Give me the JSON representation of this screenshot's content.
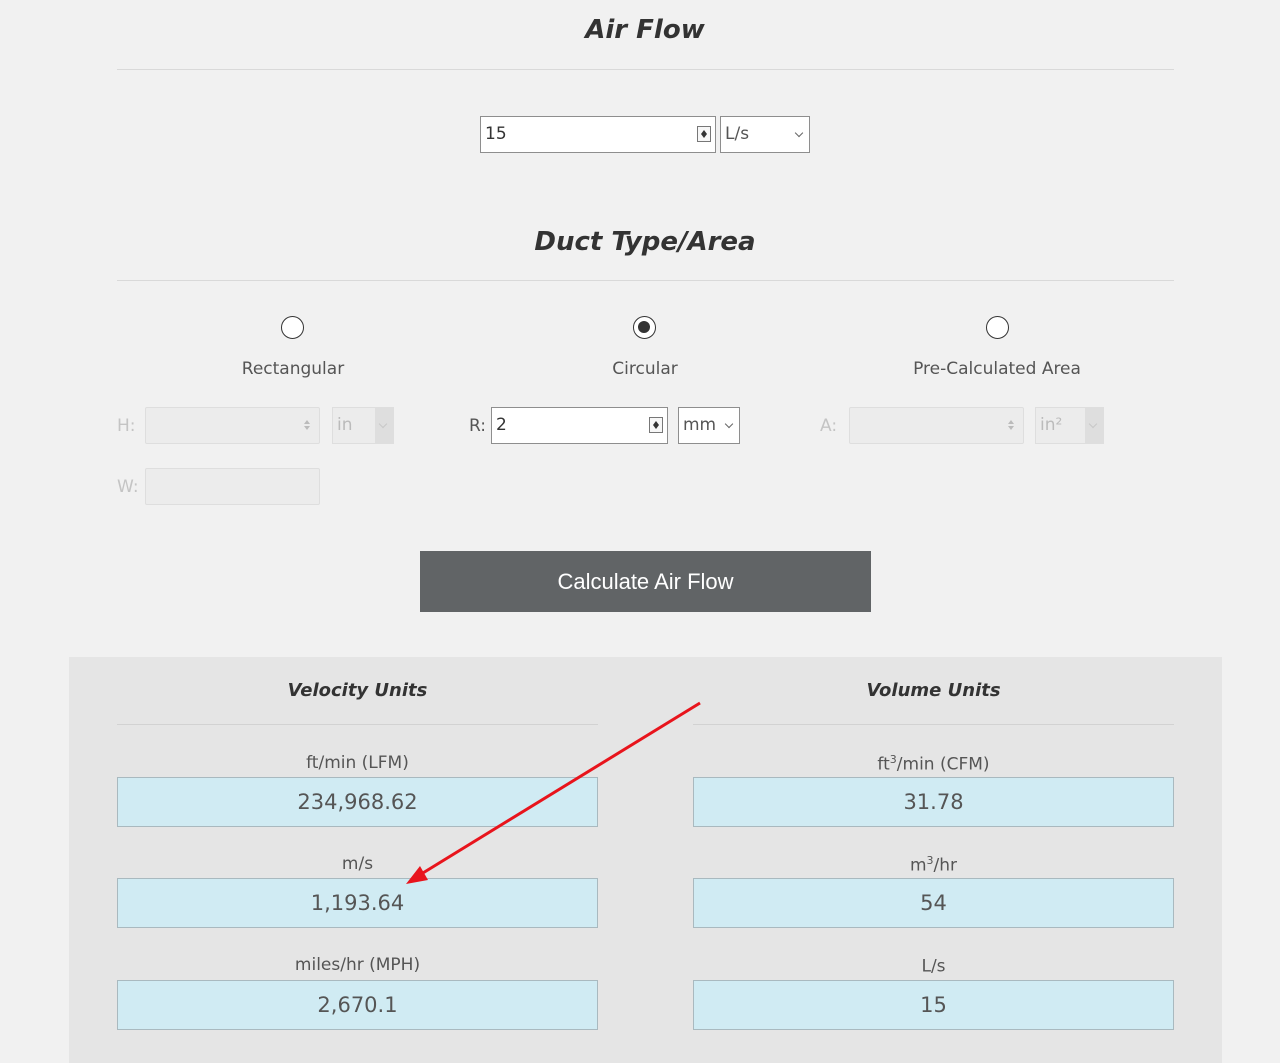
{
  "air_flow": {
    "title": "Air Flow",
    "value": "15",
    "unit": "L/s"
  },
  "duct": {
    "title": "Duct Type/Area",
    "options": [
      {
        "label": "Rectangular",
        "checked": false
      },
      {
        "label": "Circular",
        "checked": true
      },
      {
        "label": "Pre-Calculated Area",
        "checked": false
      }
    ],
    "rect": {
      "h_label": "H:",
      "w_label": "W:",
      "unit": "in"
    },
    "circ": {
      "r_label": "R:",
      "value": "2",
      "unit": "mm"
    },
    "area": {
      "a_label": "A:",
      "unit": "in²"
    }
  },
  "calculate_label": "Calculate Air Flow",
  "results": {
    "velocity_title": "Velocity Units",
    "volume_title": "Volume Units",
    "velocity": [
      {
        "label": "ft/min (LFM)",
        "value": "234,968.62"
      },
      {
        "label": "m/s",
        "value": "1,193.64"
      },
      {
        "label": "miles/hr (MPH)",
        "value": "2,670.1"
      }
    ],
    "volume": [
      {
        "label_pre": "ft",
        "label_sup": "3",
        "label_post": "/min (CFM)",
        "value": "31.78"
      },
      {
        "label_pre": "m",
        "label_sup": "3",
        "label_post": "/hr",
        "value": "54"
      },
      {
        "label_pre": "L/s",
        "label_sup": "",
        "label_post": "",
        "value": "15"
      }
    ]
  },
  "annotation_color": "#e8141c"
}
